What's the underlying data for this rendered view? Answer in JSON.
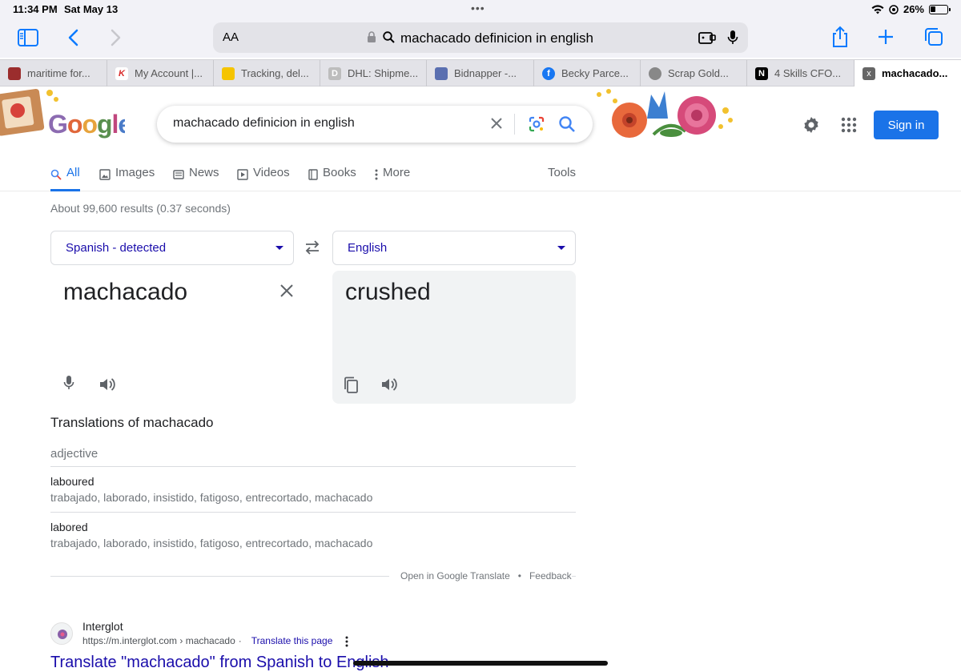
{
  "status": {
    "time": "11:34 PM",
    "date": "Sat May 13",
    "battery": "26%"
  },
  "safari": {
    "aa_label": "AA",
    "url": "machacado definicion in english"
  },
  "tabs": [
    {
      "label": "maritime for...",
      "color": "#9b2d2d",
      "glyph": ""
    },
    {
      "label": "My Account |...",
      "color": "#d92b2b",
      "glyph": "K"
    },
    {
      "label": "Tracking, del...",
      "color": "#f5c400",
      "glyph": ""
    },
    {
      "label": "DHL: Shipme...",
      "color": "#bdbdbd",
      "glyph": "D"
    },
    {
      "label": "Bidnapper -...",
      "color": "#5a6fb0",
      "glyph": ""
    },
    {
      "label": "Becky Parce...",
      "color": "#1877f2",
      "glyph": "f"
    },
    {
      "label": "Scrap Gold...",
      "color": "#888888",
      "glyph": ""
    },
    {
      "label": "4 Skills CFO...",
      "color": "#000000",
      "glyph": "N"
    },
    {
      "label": "machacado...",
      "color": "#666666",
      "glyph": "x"
    }
  ],
  "google": {
    "logo": "Google",
    "query": "machacado definicion in english",
    "signin": "Sign in",
    "nav": [
      {
        "label": "All",
        "icon": "search-icon"
      },
      {
        "label": "Images",
        "icon": "image-icon"
      },
      {
        "label": "News",
        "icon": "news-icon"
      },
      {
        "label": "Videos",
        "icon": "play-icon"
      },
      {
        "label": "Books",
        "icon": "book-icon"
      },
      {
        "label": "More",
        "icon": "kebab-icon"
      }
    ],
    "tools": "Tools",
    "stats": "About 99,600 results (0.37 seconds)"
  },
  "translate": {
    "source_lang": "Spanish - detected",
    "target_lang": "English",
    "source_text": "machacado",
    "target_text": "crushed",
    "heading": "Translations of machacado",
    "pos": "adjective",
    "rows": [
      {
        "word": "laboured",
        "synonyms": "trabajado, laborado, insistido, fatigoso, entrecortado, machacado"
      },
      {
        "word": "labored",
        "synonyms": "trabajado, laborado, insistido, fatigoso, entrecortado, machacado"
      }
    ],
    "open_link": "Open in Google Translate",
    "dot": "•",
    "feedback": "Feedback"
  },
  "result": {
    "site": "Interglot",
    "url": "https://m.interglot.com › machacado",
    "dot": "·",
    "translate_page": "Translate this page",
    "title": "Translate \"machacado\" from Spanish to English"
  }
}
